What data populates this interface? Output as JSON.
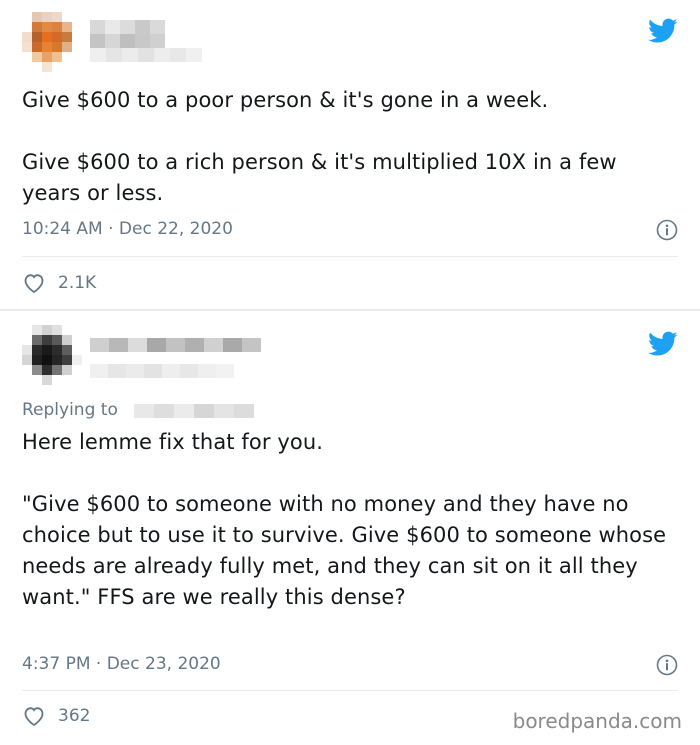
{
  "tweets": [
    {
      "text": "Give $600 to a poor person & it's gone in a week.\n\nGive $600 to a rich person & it's multiplied 10X in a few years or less.",
      "time": "10:24 AM",
      "date": "Dec 22, 2020",
      "likes": "2.1K"
    },
    {
      "replying_label": "Replying to",
      "text": "Here lemme fix that for you.\n\n\"Give $600 to someone with no money and they have no choice but to use it to survive. Give $600 to someone whose needs are already fully met, and they can sit on it all they want.\" FFS are we really this dense?",
      "time": "4:37 PM",
      "date": "Dec 23, 2020",
      "likes": "362"
    }
  ],
  "separator": "·",
  "watermark": "boredpanda.com",
  "colors": {
    "twitter_blue": "#1da1f2",
    "meta_gray": "#657786",
    "divider": "#e6ecf0"
  },
  "icons": [
    "twitter-bird-icon",
    "info-icon",
    "heart-icon"
  ]
}
